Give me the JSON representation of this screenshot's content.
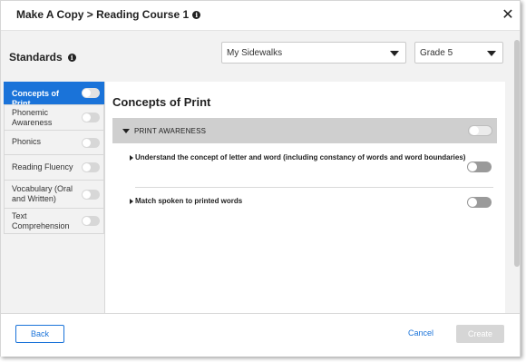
{
  "dialog": {
    "title": "Make A Copy > Reading Course 1",
    "title_info_icon": "info-icon",
    "close_icon": "close-icon",
    "close_glyph": "✕"
  },
  "standards": {
    "label": "Standards",
    "info_icon": "info-icon"
  },
  "filters": {
    "program": {
      "selected": "My Sidewalks"
    },
    "grade": {
      "selected": "Grade 5"
    }
  },
  "sidebar": {
    "items": [
      {
        "label": "Concepts of Print",
        "active": true
      },
      {
        "label": "Phonemic Awareness",
        "active": false
      },
      {
        "label": "Phonics",
        "active": false
      },
      {
        "label": "Reading Fluency",
        "active": false
      },
      {
        "label": "Vocabulary (Oral and Written)",
        "active": false
      },
      {
        "label": "Text Comprehension",
        "active": false
      }
    ]
  },
  "content": {
    "title": "Concepts of Print",
    "group": {
      "label": "PRINT AWARENESS",
      "standards": [
        {
          "text": "Understand the concept of letter and word (including constancy of words and word boundaries)"
        },
        {
          "text": "Match spoken to printed words"
        }
      ]
    }
  },
  "footer": {
    "back_label": "Back",
    "cancel_label": "Cancel",
    "create_label": "Create"
  },
  "colors": {
    "accent": "#1a73d9",
    "group_header": "#cfcfcf",
    "disabled_button": "#d6d6d6"
  }
}
